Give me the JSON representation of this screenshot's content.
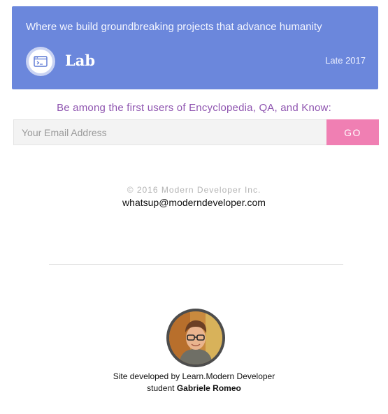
{
  "lab_card": {
    "tagline": "Where we build groundbreaking projects that advance humanity",
    "name": "Lab",
    "date": "Late 2017",
    "icon": "terminal-window-icon",
    "background_color": "#6b87dc"
  },
  "signup": {
    "prompt": "Be among the first users of Encyclopedia, QA, and Know:",
    "email_placeholder": "Your Email Address",
    "email_value": "",
    "go_label": "GO",
    "go_color": "#f07fb3",
    "prompt_color": "#8f55b0"
  },
  "footer": {
    "copyright": "© 2016 Modern Developer Inc.",
    "contact_email": "whatsup@moderndeveloper.com"
  },
  "credit": {
    "line1": "Site developed by Learn.Modern Developer",
    "line2_prefix": "student",
    "student_name": "Gabriele Romeo",
    "avatar_icon": "student-avatar"
  }
}
